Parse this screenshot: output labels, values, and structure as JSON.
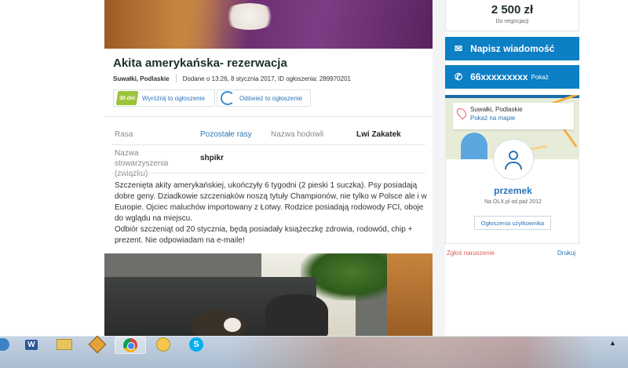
{
  "listing": {
    "title": "Akita amerykańska- rezerwacja",
    "location": "Suwałki, Podlaskie",
    "added": "Dodane o 13:26, 8 stycznia 2017, ID ogłoszenia: 289970201",
    "promo_badge": "30 dni",
    "promote_label": "Wyróżnij to ogłoszenie",
    "refresh_label": "Odśwież to ogłoszenie",
    "attributes": [
      {
        "label": "Rasa",
        "value": "Pozostałe rasy"
      },
      {
        "label": "Nazwa hodowli",
        "value": "Lwi Zakatek"
      },
      {
        "label": "Nazwa stowarzyszenia (związku)",
        "value": "shpikr"
      }
    ],
    "description": [
      "Szczenięta akity amerykańskiej, ukończyły 6 tygodni (2 pieski 1 suczka). Psy posiadają dobre geny. Dziadkowie szczeniaków noszą tytuły Championów, nie tylko w Polsce ale i w Europie. Ojciec maluchów importowany z Łotwy. Rodzice posiadają rodowody FCI, oboje do wglądu na miejscu.",
      "Odbiór szczeniąt od 20 stycznia, będą posiadały książeczkę zdrowia, rodowód, chip + prezent. Nie odpowiadam na e-maile!"
    ]
  },
  "sidebar": {
    "price": "2 500 zł",
    "negotiation": "Do negocjacji",
    "message_button": "Napisz wiadomość",
    "phone_number": "66xxxxxxxxx",
    "phone_show": "Pokaż",
    "map_location": "Suwałki, Podlaskie",
    "map_link": "Pokaż na mapie",
    "user_name": "przemek",
    "user_since": "Na OLX.pl od paź 2012",
    "user_ads": "Ogłoszenia użytkownika",
    "report": "Zgłoś naruszenie",
    "print": "Drukuj"
  },
  "taskbar": {
    "word_icon": "W",
    "skype_icon": "S",
    "tray_arrow": "▲"
  },
  "colors": {
    "accent": "#0c7fc5",
    "link": "#2a74b8",
    "report": "#e05a5a",
    "badge": "#9cc43a"
  },
  "icons": [
    "envelope-icon",
    "phone-icon",
    "map-pin-icon",
    "user-avatar-icon",
    "refresh-icon",
    "windows-start-icon",
    "word-icon",
    "explorer-icon",
    "tool-icon",
    "chrome-icon",
    "messenger-icon",
    "skype-icon"
  ]
}
